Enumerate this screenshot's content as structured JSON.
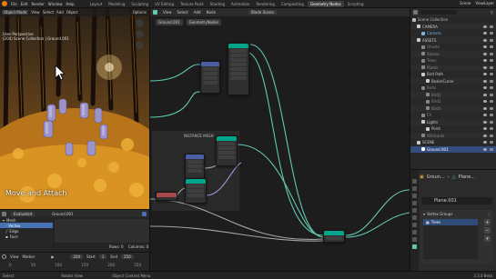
{
  "menu": [
    "File",
    "Edit",
    "Render",
    "Window",
    "Help"
  ],
  "workspace_tabs": [
    "Layout",
    "Modeling",
    "Sculpting",
    "UV Editing",
    "Texture Paint",
    "Shading",
    "Animation",
    "Rendering",
    "Compositing",
    "Geometry Nodes",
    "Scripting"
  ],
  "active_tab": "Geometry Nodes",
  "topbar_right": {
    "scene": "Scene",
    "view_layer": "ViewLayer"
  },
  "viewport": {
    "mode": "Object Mode",
    "menus": [
      "View",
      "Select",
      "Add",
      "Object"
    ],
    "options": "Options",
    "info_line1": "User Perspective",
    "info_line2": "(204) Scene Collection | Ground.001",
    "overlay_text": "Move and Attach"
  },
  "spreadsheet": {
    "mode": "Evaluated",
    "object": "Ground.001",
    "items": [
      {
        "label": "Mesh",
        "selected": false
      },
      {
        "label": "Vertex",
        "selected": true
      },
      {
        "label": "Edge",
        "selected": false
      },
      {
        "label": "Face",
        "selected": false
      }
    ],
    "rows_label": "Rows: 0",
    "columns_label": "Columns: 0"
  },
  "timeline": {
    "menus": [
      "View",
      "Marker"
    ],
    "current_frame": "204",
    "start_label": "Start",
    "start": "1",
    "end_label": "End",
    "end": "250",
    "ruler": [
      "0",
      "50",
      "100",
      "150",
      "200",
      "250"
    ]
  },
  "node_editor": {
    "menus": [
      "View",
      "Select",
      "Add",
      "Node"
    ],
    "modifier": "GeometryNodes",
    "header_title": "Blade Scene",
    "breadcrumb": [
      "Ground.001",
      "GeometryNodes"
    ],
    "frame_label": "INSTANCE MESH"
  },
  "outliner": {
    "title": "Scene",
    "rows": [
      {
        "label": "Scene Collection",
        "indent": 0,
        "color": "#bbbbbb",
        "selected": false
      },
      {
        "label": "CAMERA",
        "indent": 1,
        "color": "#cccccc",
        "selected": false
      },
      {
        "label": "Camera",
        "indent": 2,
        "color": "#7bb3e0",
        "selected": false
      },
      {
        "label": "ASSETS",
        "indent": 1,
        "color": "#cccccc",
        "selected": false
      },
      {
        "label": "Ghosts",
        "indent": 2,
        "color": "#888888",
        "selected": false
      },
      {
        "label": "Stones",
        "indent": 2,
        "color": "#888888",
        "selected": false
      },
      {
        "label": "Trees",
        "indent": 2,
        "color": "#888888",
        "selected": false
      },
      {
        "label": "Plants",
        "indent": 2,
        "color": "#888888",
        "selected": false
      },
      {
        "label": "Bird Path",
        "indent": 2,
        "color": "#cccccc",
        "selected": false
      },
      {
        "label": "BezierCurve",
        "indent": 3,
        "color": "#cccccc",
        "selected": false
      },
      {
        "label": "Birds",
        "indent": 2,
        "color": "#888888",
        "selected": false
      },
      {
        "label": "Bird1",
        "indent": 3,
        "color": "#888888",
        "selected": false
      },
      {
        "label": "Bird2",
        "indent": 3,
        "color": "#888888",
        "selected": false
      },
      {
        "label": "Bird3",
        "indent": 3,
        "color": "#888888",
        "selected": false
      },
      {
        "label": "FX",
        "indent": 2,
        "color": "#888888",
        "selected": false
      },
      {
        "label": "Lights",
        "indent": 2,
        "color": "#cccccc",
        "selected": false
      },
      {
        "label": "Point",
        "indent": 3,
        "color": "#cccccc",
        "selected": false
      },
      {
        "label": "Wildcards",
        "indent": 2,
        "color": "#888888",
        "selected": false
      },
      {
        "label": "SCENE",
        "indent": 1,
        "color": "#cccccc",
        "selected": false
      },
      {
        "label": "Ground.001",
        "indent": 2,
        "color": "#ffffff",
        "selected": true
      }
    ]
  },
  "properties": {
    "breadcrumb": [
      "Groun...",
      "Plane..."
    ],
    "mesh_name": "Plane.001",
    "panel_title": "Vertex Groups",
    "vertex_group": "Trees",
    "add_symbol": "+",
    "remove_symbol": "−"
  },
  "statusbar": {
    "items": [
      "Select",
      "Rotate View",
      "Object Context Menu"
    ],
    "version": "3.3.0 Beta"
  },
  "colors": {
    "accent": "#4772b3",
    "link_teal": "#63c8b0",
    "link_gray": "#a5a5a5",
    "node_geometry": "#00a58a",
    "node_input": "#a64a4a",
    "node_vector": "#4a5ea6"
  }
}
